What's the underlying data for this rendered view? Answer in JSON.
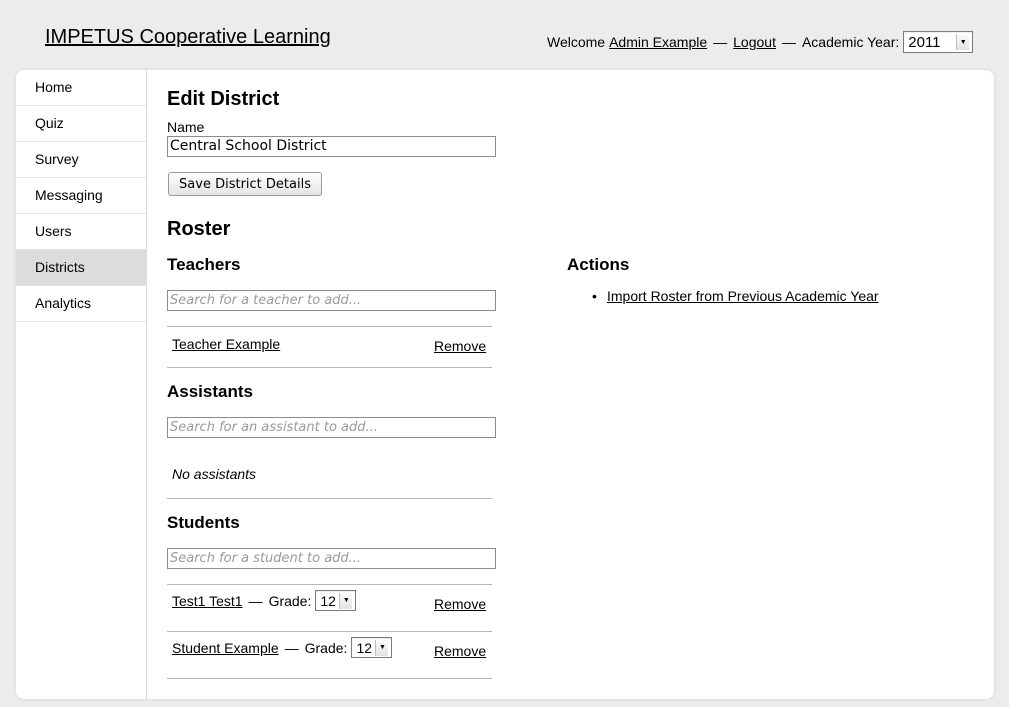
{
  "header": {
    "site_title": "IMPETUS Cooperative Learning",
    "welcome_text": "Welcome",
    "user_name": "Admin Example",
    "separator": "—",
    "logout_label": "Logout",
    "academic_year_label": "Academic Year:",
    "academic_year_value": "2011"
  },
  "sidebar": {
    "items": [
      {
        "label": "Home"
      },
      {
        "label": "Quiz"
      },
      {
        "label": "Survey"
      },
      {
        "label": "Messaging"
      },
      {
        "label": "Users"
      },
      {
        "label": "Districts",
        "active": true
      },
      {
        "label": "Analytics"
      }
    ]
  },
  "main": {
    "heading": "Edit District",
    "name_label": "Name",
    "name_value": "Central School District",
    "save_button_label": "Save District Details",
    "roster_heading": "Roster",
    "teachers": {
      "heading": "Teachers",
      "search_placeholder": "Search for a teacher to add...",
      "rows": [
        {
          "name": "Teacher Example",
          "remove_label": "Remove"
        }
      ]
    },
    "assistants": {
      "heading": "Assistants",
      "search_placeholder": "Search for an assistant to add...",
      "empty_text": "No assistants"
    },
    "students": {
      "heading": "Students",
      "search_placeholder": "Search for a student to add...",
      "grade_label": "Grade:",
      "rows": [
        {
          "name": "Test1 Test1",
          "grade": "12",
          "remove_label": "Remove"
        },
        {
          "name": "Student Example",
          "grade": "12",
          "remove_label": "Remove"
        }
      ]
    },
    "actions": {
      "heading": "Actions",
      "items": [
        {
          "label": "Import Roster from Previous Academic Year"
        }
      ]
    }
  }
}
